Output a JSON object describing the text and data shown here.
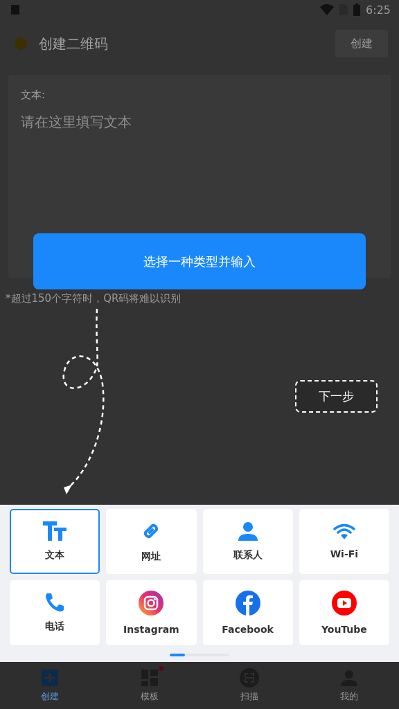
{
  "status_bar": {
    "time": "6:25"
  },
  "app_bar": {
    "title": "创建二维码",
    "action": "创建"
  },
  "editor": {
    "label": "文本:",
    "placeholder": "请在这里填写文本"
  },
  "hint": "*超过150个字符时，QR码将难以识别",
  "guide": {
    "message": "选择一种类型并输入",
    "next": "下一步"
  },
  "types": [
    {
      "kind": "text",
      "label": "文本",
      "selected": true
    },
    {
      "kind": "url",
      "label": "网址",
      "selected": false
    },
    {
      "kind": "contact",
      "label": "联系人",
      "selected": false
    },
    {
      "kind": "wifi",
      "label": "Wi-Fi",
      "selected": false
    },
    {
      "kind": "phone",
      "label": "电话",
      "selected": false
    },
    {
      "kind": "instagram",
      "label": "Instagram",
      "selected": false
    },
    {
      "kind": "facebook",
      "label": "Facebook",
      "selected": false
    },
    {
      "kind": "youtube",
      "label": "YouTube",
      "selected": false
    }
  ],
  "nav": [
    {
      "kind": "create",
      "label": "创建",
      "selected": true,
      "badge": false
    },
    {
      "kind": "templates",
      "label": "模板",
      "selected": false,
      "badge": true
    },
    {
      "kind": "scan",
      "label": "扫描",
      "selected": false,
      "badge": false
    },
    {
      "kind": "profile",
      "label": "我的",
      "selected": false,
      "badge": false
    }
  ]
}
